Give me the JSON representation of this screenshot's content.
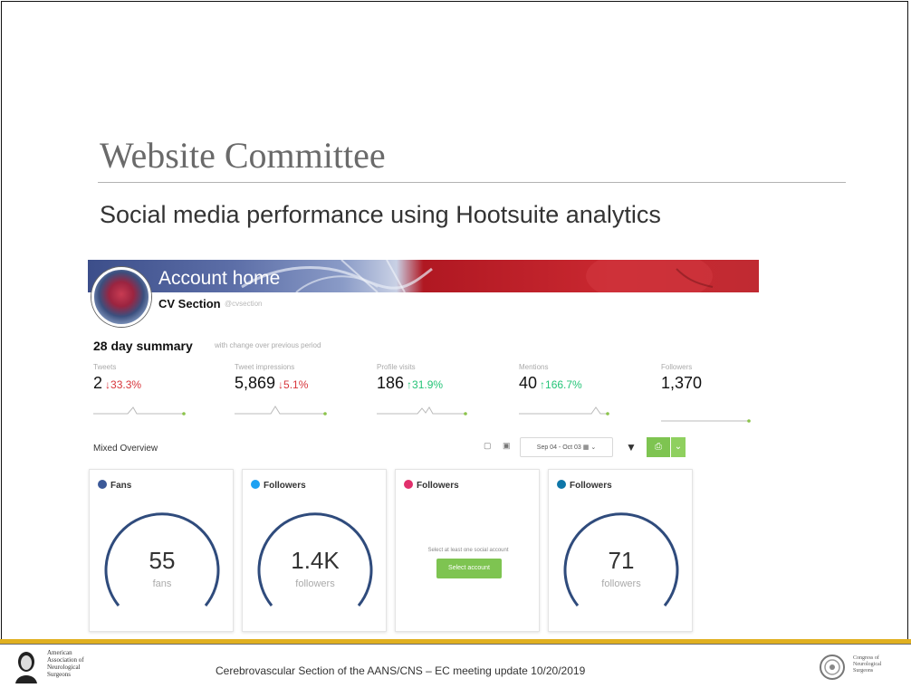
{
  "slide": {
    "title": "Website Committee",
    "subtitle": "Social media performance using Hootsuite analytics",
    "footer": "Cerebrovascular Section of the AANS/CNS – EC meeting update 10/20/2019",
    "left_logo_text": [
      "American",
      "Association of",
      "Neurological",
      "Surgeons"
    ],
    "right_logo_text": [
      "Congress of",
      "Neurological",
      "Surgeons"
    ],
    "accent_color": "#e0b020"
  },
  "account": {
    "banner_title": "Account home",
    "name": "CV Section",
    "handle": "@cvsection"
  },
  "summary": {
    "title": "28 day summary",
    "subtitle": "with change over previous period",
    "metrics": [
      {
        "label": "Tweets",
        "value": "2",
        "change": "↓33.3%",
        "direction": "down"
      },
      {
        "label": "Tweet impressions",
        "value": "5,869",
        "change": "↓5.1%",
        "direction": "down"
      },
      {
        "label": "Profile visits",
        "value": "186",
        "change": "↑31.9%",
        "direction": "up"
      },
      {
        "label": "Mentions",
        "value": "40",
        "change": "↑166.7%",
        "direction": "up"
      },
      {
        "label": "Followers",
        "value": "1,370",
        "change": "",
        "direction": "none"
      }
    ]
  },
  "overview": {
    "title": "Mixed Overview",
    "date_range": "Sep 04 - Oct 03",
    "filter_icon": "filter-icon",
    "cards": [
      {
        "network": "facebook",
        "icon_color": "#3b5998",
        "label": "Fans",
        "value": "55",
        "unit": "fans"
      },
      {
        "network": "twitter",
        "icon_color": "#1da1f2",
        "label": "Followers",
        "value": "1.4K",
        "unit": "followers"
      },
      {
        "network": "instagram",
        "icon_color": "#e1306c",
        "label": "Followers",
        "prompt": "Select at least one social account",
        "button": "Select account"
      },
      {
        "network": "linkedin",
        "icon_color": "#0e76a8",
        "label": "Followers",
        "value": "71",
        "unit": "followers"
      }
    ]
  },
  "colors": {
    "gauge": "#2f4b7c",
    "button_green": "#7ec451",
    "down": "#d7353b",
    "up": "#24c477"
  }
}
